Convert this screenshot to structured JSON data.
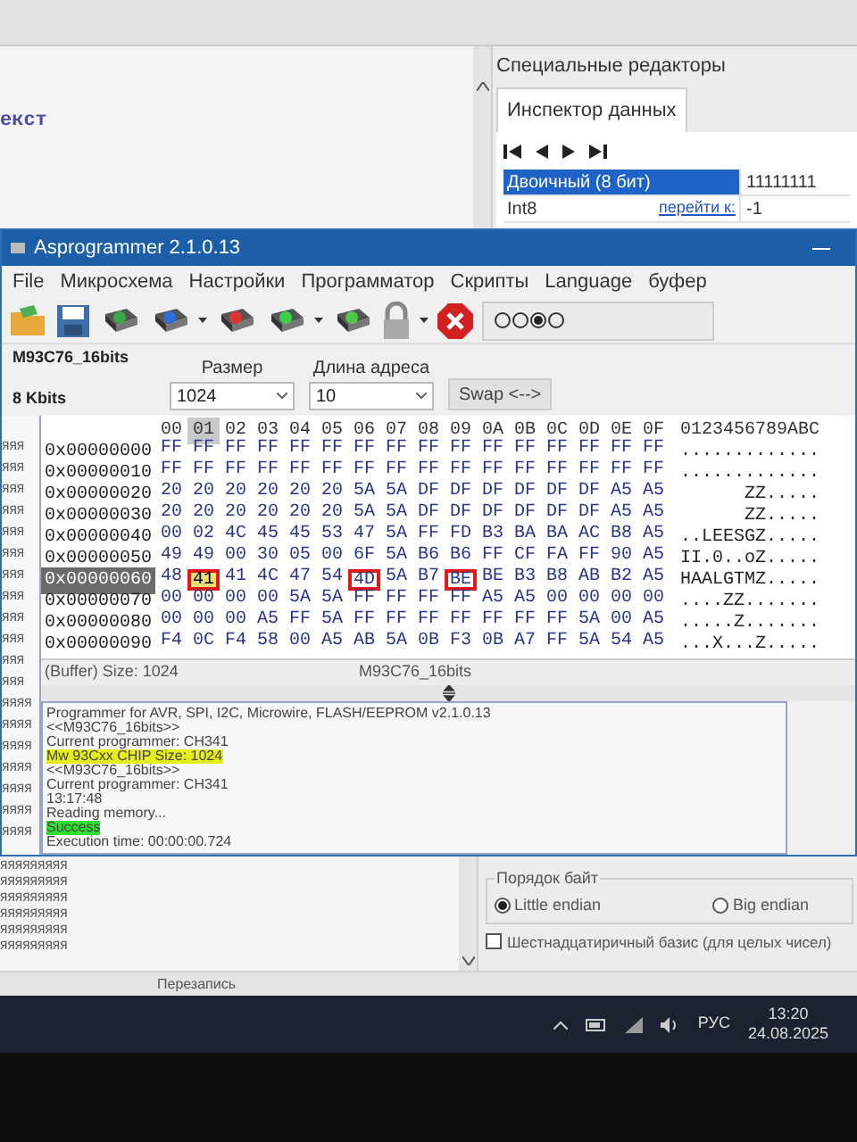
{
  "background_editor": {
    "left_panel": {
      "heading": "екст",
      "lines_lower": [
        "ЯЯЯЯЯЯЯЯЯ",
        "ЯЯЯЯЯЯЯЯЯ",
        "ЯЯЯЯЯЯЯЯЯ",
        "ЯЯЯЯЯЯЯЯЯ",
        "ЯЯЯЯЯЯЯЯЯ",
        "ЯЯЯЯЯЯЯЯЯ"
      ]
    },
    "special_editors": {
      "title": "Специальные редакторы",
      "tabs": [
        {
          "label": "Инспектор данных",
          "selected": true
        }
      ],
      "rows": [
        {
          "label": "Двоичный (8 бит)",
          "value": "11111111",
          "selected": true
        },
        {
          "label": "Int8",
          "link": "перейти к:",
          "value": "-1",
          "selected": false
        }
      ],
      "byte_order": {
        "title": "Порядок байт",
        "options": [
          {
            "label": "Little endian",
            "selected": true
          },
          {
            "label": "Big endian",
            "selected": false
          }
        ]
      },
      "hex_base": {
        "label": "Шестнадцатиричный базис (для целых чисел)",
        "checked": false
      }
    },
    "status_bar": {
      "mode": "Перезапись"
    }
  },
  "window": {
    "title": "Asprogrammer 2.1.0.13",
    "menu": [
      "File",
      "Микросхема",
      "Настройки",
      "Программатор",
      "Скрипты",
      "Language",
      "буфер"
    ],
    "toolbar_radios": [
      {
        "selected": false
      },
      {
        "selected": false
      },
      {
        "selected": true
      },
      {
        "selected": false
      }
    ],
    "chip": {
      "name": "M93C76_16bits",
      "capacity": "8 Kbits",
      "size_label": "Размер",
      "size_value": "1024",
      "addr_label": "Длина адреса",
      "addr_value": "10",
      "swap_button": "Swap <-->"
    },
    "left_strip": [
      "ЯЯЯ",
      "ЯЯЯ",
      "ЯЯЯ",
      "ЯЯЯ",
      "ЯЯЯ",
      "ЯЯЯ",
      "ЯЯЯ",
      "ЯЯЯ",
      "ЯЯЯ",
      "ЯЯЯ",
      "ЯЯЯ",
      "ЯЯЯ",
      "ЯЯЯЯ",
      "ЯЯЯЯ",
      "ЯЯЯЯ",
      "ЯЯЯЯ",
      "ЯЯЯЯ",
      "ЯЯЯЯ",
      "ЯЯЯЯ"
    ],
    "hex": {
      "columns": [
        {
          "label": "00",
          "cursor": false
        },
        {
          "label": "01",
          "cursor": true
        },
        {
          "label": "02",
          "cursor": false
        },
        {
          "label": "03",
          "cursor": false
        },
        {
          "label": "04",
          "cursor": false
        },
        {
          "label": "05",
          "cursor": false
        },
        {
          "label": "06",
          "cursor": false
        },
        {
          "label": "07",
          "cursor": false
        },
        {
          "label": "08",
          "cursor": false
        },
        {
          "label": "09",
          "cursor": false
        },
        {
          "label": "0A",
          "cursor": false
        },
        {
          "label": "0B",
          "cursor": false
        },
        {
          "label": "0C",
          "cursor": false
        },
        {
          "label": "0D",
          "cursor": false
        },
        {
          "label": "0E",
          "cursor": false
        },
        {
          "label": "0F",
          "cursor": false
        }
      ],
      "ascii_header": "0123456789ABC",
      "rows": [
        {
          "address": "0x00000000",
          "selected": false,
          "bytes": [
            "FF",
            "FF",
            "FF",
            "FF",
            "FF",
            "FF",
            "FF",
            "FF",
            "FF",
            "FF",
            "FF",
            "FF",
            "FF",
            "FF",
            "FF",
            "FF"
          ],
          "ascii": "............."
        },
        {
          "address": "0x00000010",
          "selected": false,
          "bytes": [
            "FF",
            "FF",
            "FF",
            "FF",
            "FF",
            "FF",
            "FF",
            "FF",
            "FF",
            "FF",
            "FF",
            "FF",
            "FF",
            "FF",
            "FF",
            "FF"
          ],
          "ascii": "............."
        },
        {
          "address": "0x00000020",
          "selected": false,
          "bytes": [
            "20",
            "20",
            "20",
            "20",
            "20",
            "20",
            "5A",
            "5A",
            "DF",
            "DF",
            "DF",
            "DF",
            "DF",
            "DF",
            "A5",
            "A5"
          ],
          "ascii": "      ZZ....."
        },
        {
          "address": "0x00000030",
          "selected": false,
          "bytes": [
            "20",
            "20",
            "20",
            "20",
            "20",
            "20",
            "5A",
            "5A",
            "DF",
            "DF",
            "DF",
            "DF",
            "DF",
            "DF",
            "A5",
            "A5"
          ],
          "ascii": "      ZZ....."
        },
        {
          "address": "0x00000040",
          "selected": false,
          "bytes": [
            "00",
            "02",
            "4C",
            "45",
            "45",
            "53",
            "47",
            "5A",
            "FF",
            "FD",
            "B3",
            "BA",
            "BA",
            "AC",
            "B8",
            "A5"
          ],
          "ascii": "..LEESGZ....."
        },
        {
          "address": "0x00000050",
          "selected": false,
          "bytes": [
            "49",
            "49",
            "00",
            "30",
            "05",
            "00",
            "6F",
            "5A",
            "B6",
            "B6",
            "FF",
            "CF",
            "FA",
            "FF",
            "90",
            "A5"
          ],
          "ascii": "II.0..oZ....."
        },
        {
          "address": "0x00000060",
          "selected": true,
          "bytes": [
            "48",
            "41",
            "41",
            "4C",
            "47",
            "54",
            "4D",
            "5A",
            "B7",
            "BE",
            "BE",
            "B3",
            "B8",
            "AB",
            "B2",
            "A5"
          ],
          "marked": [
            false,
            true,
            false,
            false,
            false,
            false,
            true,
            false,
            false,
            true,
            false,
            false,
            false,
            false,
            false,
            false
          ],
          "cursor": [
            false,
            true,
            false,
            false,
            false,
            false,
            false,
            false,
            false,
            false,
            false,
            false,
            false,
            false,
            false,
            false
          ],
          "ascii": "HAALGTMZ....."
        },
        {
          "address": "0x00000070",
          "selected": false,
          "bytes": [
            "00",
            "00",
            "00",
            "00",
            "5A",
            "5A",
            "FF",
            "FF",
            "FF",
            "FF",
            "A5",
            "A5",
            "00",
            "00",
            "00",
            "00"
          ],
          "ascii": "....ZZ......."
        },
        {
          "address": "0x00000080",
          "selected": false,
          "bytes": [
            "00",
            "00",
            "00",
            "A5",
            "FF",
            "5A",
            "FF",
            "FF",
            "FF",
            "FF",
            "FF",
            "FF",
            "FF",
            "5A",
            "00",
            "A5"
          ],
          "ascii": ".....Z......."
        },
        {
          "address": "0x00000090",
          "selected": false,
          "bytes": [
            "F4",
            "0C",
            "F4",
            "58",
            "00",
            "A5",
            "AB",
            "5A",
            "0B",
            "F3",
            "0B",
            "A7",
            "FF",
            "5A",
            "54",
            "A5"
          ],
          "ascii": "...X...Z....."
        }
      ]
    },
    "buffer_status": {
      "size": "(Buffer) Size: 1024",
      "chip": "M93C76_16bits"
    },
    "log": [
      {
        "text": "Programmer for AVR, SPI, I2C, Microwire, FLASH/EEPROM v2.1.0.13"
      },
      {
        "text": "<<M93C76_16bits>>"
      },
      {
        "text": "Current programmer: CH341"
      },
      {
        "text": "Mw 93Cxx CHIP Size: 1024",
        "color": "#e6ee1a"
      },
      {
        "text": "<<M93C76_16bits>>"
      },
      {
        "text": "Current programmer: CH341"
      },
      {
        "text": "13:17:48"
      },
      {
        "text": "Reading memory..."
      },
      {
        "text": "Success",
        "color": "#2ee02e"
      },
      {
        "text": "Execution time: 00:00:00.724"
      }
    ]
  },
  "taskbar": {
    "language": "РУС",
    "time": "13:20",
    "date": "24.08.2025"
  }
}
